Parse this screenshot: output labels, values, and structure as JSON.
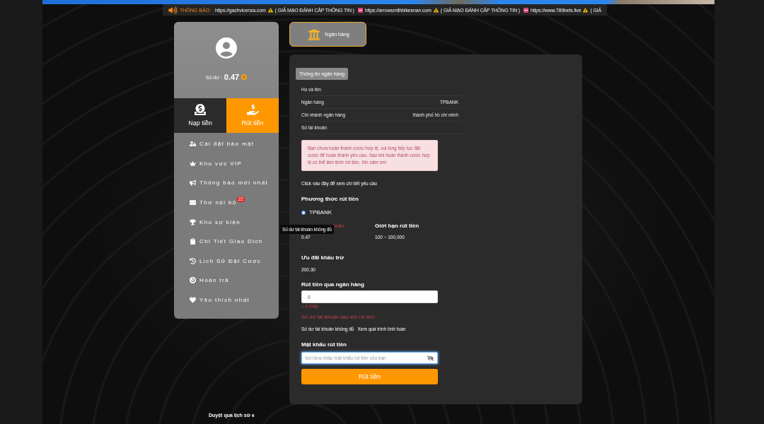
{
  "notice_bar": {
    "label": "THÔNG BÁO:",
    "items": [
      {
        "url": "https://gachvicenza.com",
        "note": "( GIẢ MẠO ĐÁNH CẮP THÔNG TIN )"
      },
      {
        "url": "https://arrowsmithbikesnan.com",
        "note": "( GIẢ MẠO ĐÁNH CẮP THÔNG TIN )"
      },
      {
        "url": "https://www.789bets.live",
        "note": "( GIẢ"
      }
    ]
  },
  "account": {
    "balance_label": "Số dư :",
    "balance": "0.47"
  },
  "wallet_tabs": [
    {
      "label": "Nạp tiền",
      "selected": false
    },
    {
      "label": "Rút tiền",
      "selected": true
    }
  ],
  "menu": [
    {
      "label": "Cài đặt bảo mật"
    },
    {
      "label": "Khu vực VIP"
    },
    {
      "label": "Thông báo mới nhất"
    },
    {
      "label": "Thư nội bộ",
      "badge": "22"
    },
    {
      "label": "Khu sự kiện"
    },
    {
      "label": "Chi Tiết Giao Dịch"
    },
    {
      "label": "Lịch Sử Đặt Cược"
    },
    {
      "label": "Hoàn trả"
    },
    {
      "label": "Yêu thích nhất"
    }
  ],
  "method_tabs": [
    {
      "label": "Ngân hàng",
      "selected": true
    }
  ],
  "bank_info": {
    "title": "Thông tin ngân hàng",
    "rows": [
      {
        "label": "Họ và tên"
      },
      {
        "label": "Ngân hàng",
        "value": "TPBANK"
      },
      {
        "label": "Chi nhánh ngân hàng",
        "value": "thành phố hồ chí minh"
      },
      {
        "label": "Số tài khoản"
      }
    ]
  },
  "alert": "Bạn chưa hoàn thành cược hợp lệ, vui lòng tiếp tục đặt cược để hoàn thành yêu cầu. Sau khi hoàn thành cược hợp lệ có thể làm lệnh rút tiền. Xin cảm ơn!",
  "details_link": "Click vào đây để xem chi tiết yêu cầu",
  "withdraw_method": {
    "title": "Phương thức rút tiền",
    "options": [
      {
        "label": "TPBANK",
        "selected": true
      }
    ]
  },
  "balance_stats": [
    {
      "kind": "warning",
      "label": "hoản",
      "value": "0.47"
    },
    {
      "kind": "plain",
      "label": "Giới hạn rút tiền",
      "value": "100 ~ 100,000"
    }
  ],
  "discount": {
    "label": "Ưu đãi khấu trừ",
    "value": "200.30"
  },
  "amount": {
    "label": "Rút tiền qua ngân hàng",
    "value": "0",
    "converted": "≈ 0 VND"
  },
  "after_balance": {
    "label": "Số dư tài khoản sau khi rút tiền",
    "status": "Số dư tài khoản không đủ",
    "link": "Xem quá trình tính toán"
  },
  "password": {
    "label": "Mật khẩu rút tiền",
    "placeholder": "Vui lòng nhập mật khẩu rút tiền của bạn",
    "focused": true
  },
  "submit": "Rút tiền",
  "tooltip": "Số dư tài khoản không đủ",
  "footer": {
    "history": "Duyệt qua lịch sử ±"
  }
}
